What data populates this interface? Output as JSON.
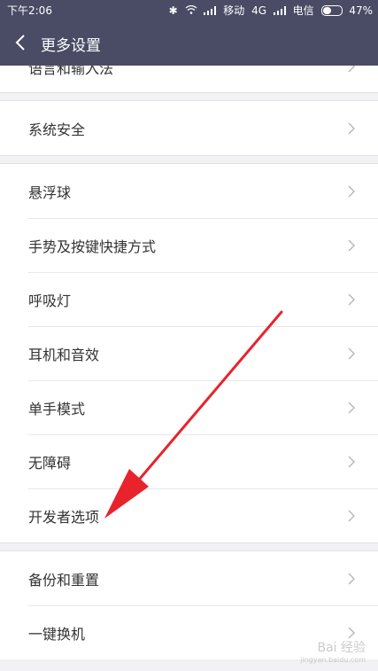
{
  "status_bar": {
    "time": "下午2:06",
    "carrier1": "移动",
    "network": "4G",
    "carrier2": "电信",
    "battery": "47%"
  },
  "header": {
    "title": "更多设置"
  },
  "partial_item": "语言和输入法",
  "groups": [
    [
      "系统安全"
    ],
    [
      "悬浮球",
      "手势及按键快捷方式",
      "呼吸灯",
      "耳机和音效",
      "单手模式",
      "无障碍",
      "开发者选项"
    ],
    [
      "备份和重置",
      "一键换机"
    ]
  ],
  "watermark": {
    "text": "Bai 经验",
    "url": "jingyan.baidu.com"
  },
  "colors": {
    "header": "#4a4c66",
    "arrow": "#e8232b",
    "background": "#f2f2f4"
  }
}
